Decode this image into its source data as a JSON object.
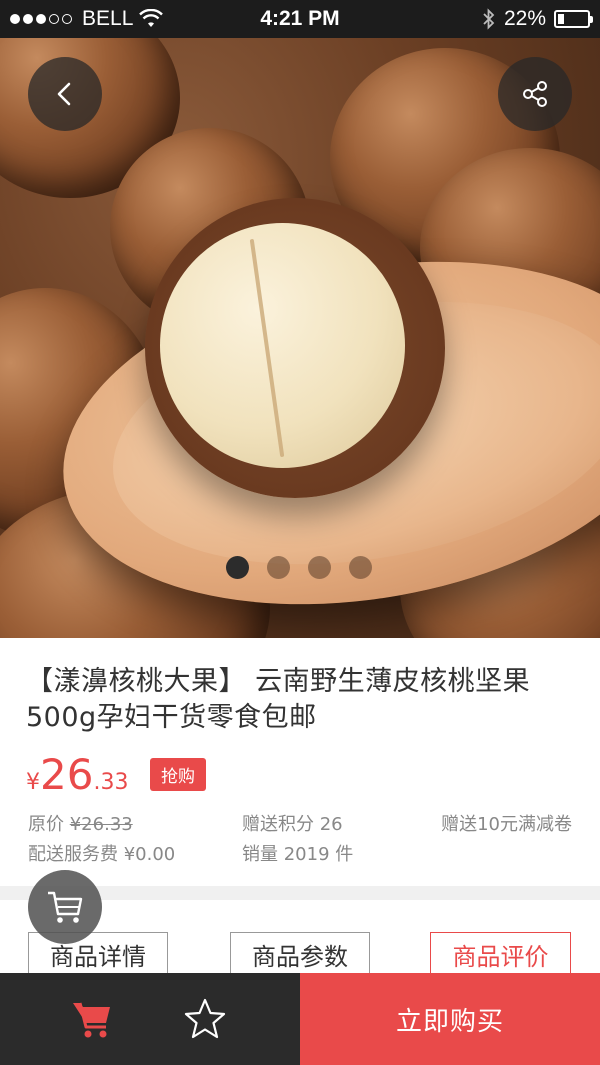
{
  "status_bar": {
    "carrier": "BELL",
    "time": "4:21 PM",
    "battery": "22%",
    "battery_level": 0.22
  },
  "gallery": {
    "image_count": 4,
    "active_index": 0
  },
  "product": {
    "title": "【漾濞核桃大果】 云南野生薄皮核桃坚果500g孕妇干货零食包邮",
    "price_currency": "¥",
    "price_integer": "26",
    "price_decimal": ".33",
    "tag": "抢购",
    "original_price_label": "原价",
    "original_price": "¥26.33",
    "points": "赠送积分 26",
    "coupon": "赠送10元满减卷",
    "shipping": "配送服务费 ¥0.00",
    "sales": "销量 2019 件"
  },
  "tabs": [
    {
      "label": "商品详情"
    },
    {
      "label": "商品参数"
    },
    {
      "label": "商品评价"
    }
  ],
  "active_tab": 2,
  "bottom_bar": {
    "buy_label": "立即购买"
  },
  "colors": {
    "accent": "#e94a4a",
    "dark_bar": "#2b2b2b",
    "status_bar": "#1c1c1c"
  }
}
